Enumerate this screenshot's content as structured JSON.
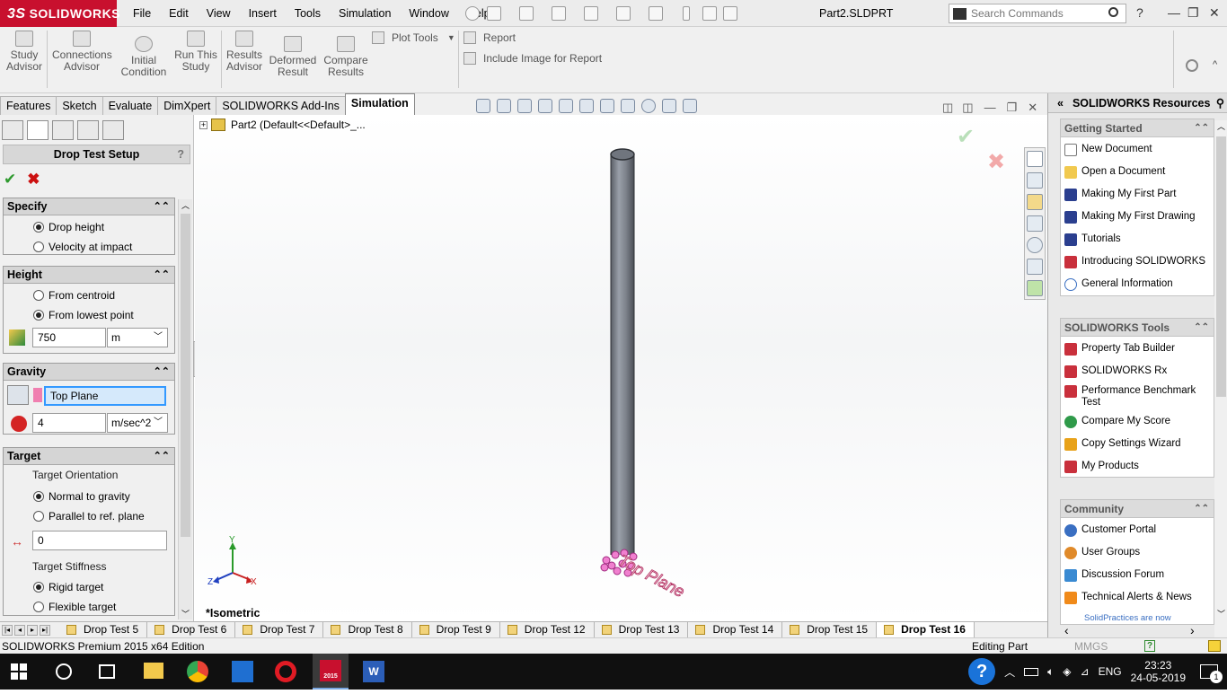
{
  "app": {
    "logo_prefix": "3S",
    "logo": "SOLIDWORKS",
    "menu": [
      "File",
      "Edit",
      "View",
      "Insert",
      "Tools",
      "Simulation",
      "Window",
      "Help"
    ],
    "filename": "Part2.SLDPRT",
    "search_placeholder": "Search Commands",
    "help_button": "?",
    "colors": {
      "brand": "#c8102e",
      "accent": "#2f9a2f",
      "cancel": "#cc1010",
      "selection": "#3399ff",
      "plane": "#c03a6a"
    }
  },
  "ribbon": {
    "buttons": [
      {
        "label": "Study\nAdvisor",
        "id": "study-advisor"
      },
      {
        "label": "Connections\nAdvisor",
        "id": "connections-advisor"
      },
      {
        "label": "Initial\nCondition",
        "id": "initial-condition"
      },
      {
        "label": "Run This\nStudy",
        "id": "run-this-study"
      },
      {
        "label": "Results\nAdvisor",
        "id": "results-advisor"
      },
      {
        "label": "Deformed\nResult",
        "id": "deformed-result"
      },
      {
        "label": "Compare\nResults",
        "id": "compare-results"
      }
    ],
    "plot_tools": "Plot Tools",
    "report": "Report",
    "include_image": "Include Image for Report"
  },
  "cmd_tabs": [
    {
      "label": "Features",
      "active": false
    },
    {
      "label": "Sketch",
      "active": false
    },
    {
      "label": "Evaluate",
      "active": false
    },
    {
      "label": "DimXpert",
      "active": false
    },
    {
      "label": "SOLIDWORKS Add-Ins",
      "active": false
    },
    {
      "label": "Simulation",
      "active": true
    }
  ],
  "panel": {
    "title": "Drop Test Setup",
    "help": "?",
    "specify": {
      "title": "Specify",
      "opt_drop_height": "Drop height",
      "opt_velocity": "Velocity at impact",
      "selected": "Drop height"
    },
    "height": {
      "title": "Height",
      "opt_centroid": "From centroid",
      "opt_lowest": "From lowest point",
      "selected": "From lowest point",
      "value": "750",
      "unit": "m"
    },
    "gravity": {
      "title": "Gravity",
      "reference": "Top Plane",
      "value": "4",
      "unit": "m/sec^2"
    },
    "target": {
      "title": "Target",
      "orientation_label": "Target Orientation",
      "opt_normal": "Normal to gravity",
      "opt_parallel": "Parallel to ref. plane",
      "selected_orientation": "Normal to gravity",
      "offset_value": "0",
      "stiffness_label": "Target Stiffness",
      "opt_rigid": "Rigid target",
      "opt_flexible": "Flexible target",
      "selected_stiffness": "Rigid target"
    }
  },
  "viewport": {
    "tree_item": "Part2  (Default<<Default>_...",
    "view_name": "*Isometric",
    "plane_label": "Top Plane",
    "triad": {
      "x": "X",
      "y": "Y",
      "z": "Z"
    }
  },
  "study_tabs": [
    "Drop Test 5",
    "Drop Test 6",
    "Drop Test 7",
    "Drop Test 8",
    "Drop Test 9",
    "Drop Test 12",
    "Drop Test 13",
    "Drop Test 14",
    "Drop Test 15",
    "Drop Test 16"
  ],
  "active_study": "Drop Test 16",
  "status": {
    "edition": "SOLIDWORKS Premium 2015 x64 Edition",
    "mode": "Editing Part",
    "units": "MMGS"
  },
  "task_pane": {
    "title": "SOLIDWORKS Resources",
    "sections": [
      {
        "title": "Getting Started",
        "items": [
          "New Document",
          "Open a Document",
          "Making My First Part",
          "Making My First Drawing",
          "Tutorials",
          "Introducing SOLIDWORKS",
          "General Information"
        ]
      },
      {
        "title": "SOLIDWORKS Tools",
        "items": [
          "Property Tab Builder",
          "SOLIDWORKS Rx",
          "Performance Benchmark Test",
          "Compare My Score",
          "Copy Settings Wizard",
          "My Products"
        ]
      },
      {
        "title": "Community",
        "items": [
          "Customer Portal",
          "User Groups",
          "Discussion Forum",
          "Technical Alerts & News"
        ]
      }
    ],
    "footer_link": "SolidPractices are now"
  },
  "taskbar": {
    "language": "ENG",
    "time": "23:23",
    "date": "24-05-2019",
    "notification_count": "1",
    "sw_badge": "2015"
  }
}
